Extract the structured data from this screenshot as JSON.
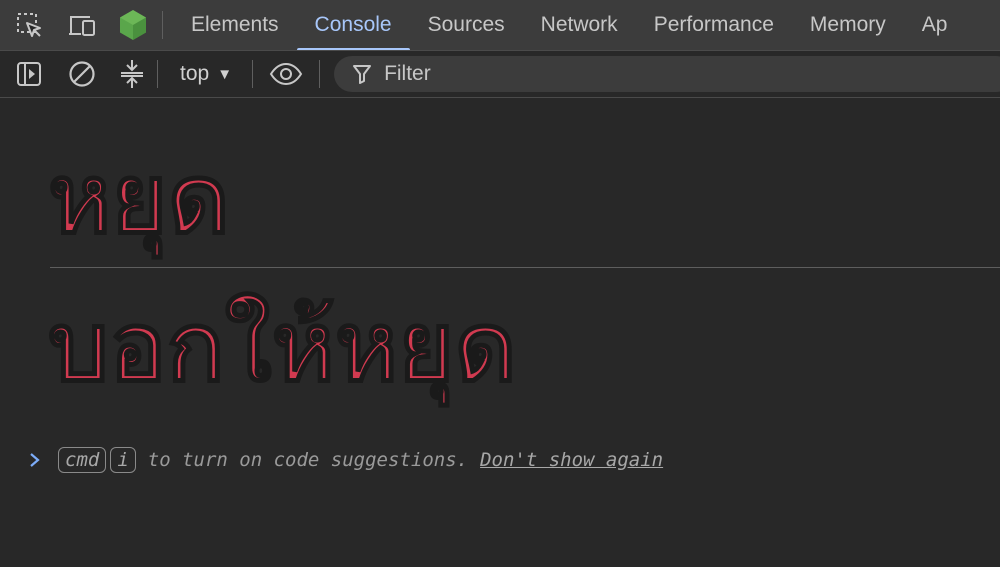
{
  "tabbar": {
    "icons": {
      "inspect": "inspect-element-icon",
      "device": "device-toolbar-icon",
      "node": "nodejs-icon"
    },
    "tabs": [
      {
        "label": "Elements",
        "active": false
      },
      {
        "label": "Console",
        "active": true
      },
      {
        "label": "Sources",
        "active": false
      },
      {
        "label": "Network",
        "active": false
      },
      {
        "label": "Performance",
        "active": false
      },
      {
        "label": "Memory",
        "active": false
      },
      {
        "label": "Ap",
        "active": false
      }
    ]
  },
  "toolbar": {
    "context_label": "top",
    "filter_placeholder": "Filter"
  },
  "console": {
    "messages": [
      "หยุด",
      "บอกให้หยุด"
    ],
    "hint": {
      "key1": "cmd",
      "key2": "i",
      "text": "to turn on code suggestions.",
      "link": "Don't show again"
    }
  },
  "colors": {
    "accent": "#a8c7fa",
    "message_text": "#d13a50",
    "background": "#282828",
    "tabbar_background": "#3c3c3c"
  }
}
